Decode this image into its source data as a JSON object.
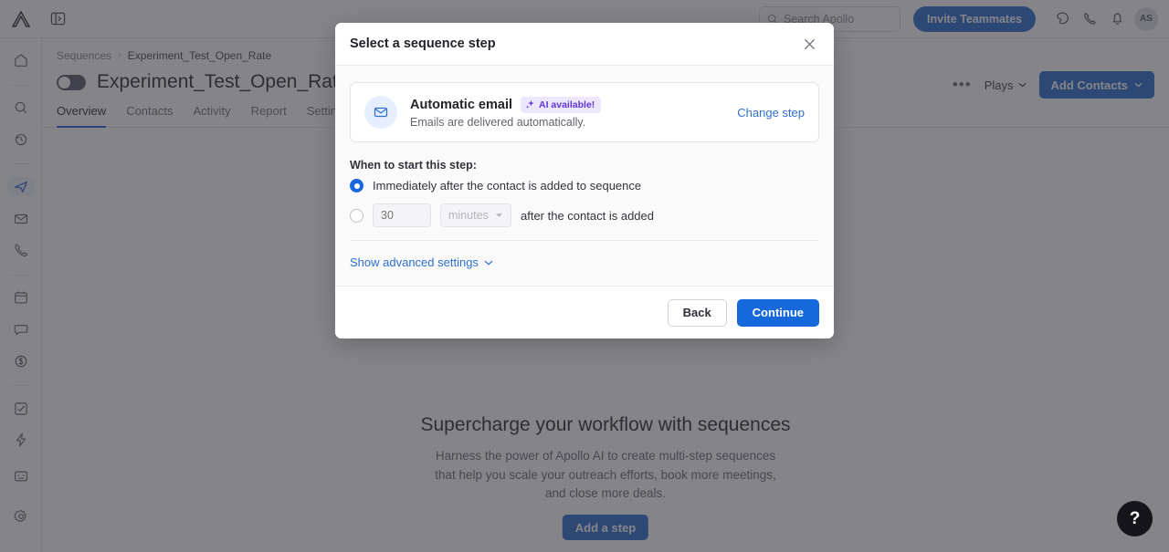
{
  "topbar": {
    "logo": "apollo-logo",
    "panel_toggle_icon": "panel-toggle-icon",
    "search": {
      "placeholder": "Search Apollo",
      "icon": "search-icon"
    },
    "invite_label": "Invite Teammates",
    "icons": [
      "tag-icon",
      "phone-icon",
      "bell-icon"
    ],
    "avatar_initials": "AS"
  },
  "rail": {
    "items": [
      {
        "name": "home",
        "icon": "home-icon",
        "active": false
      },
      {
        "name": "search",
        "icon": "search-icon",
        "active": false
      },
      {
        "name": "data-refresh",
        "icon": "data-refresh-icon",
        "active": false
      },
      {
        "name": "sequences",
        "icon": "send-icon",
        "active": true
      },
      {
        "name": "emails",
        "icon": "envelope-icon",
        "active": false
      },
      {
        "name": "calls",
        "icon": "phone-icon",
        "active": false
      },
      {
        "name": "meetings",
        "icon": "calendar-icon",
        "active": false
      },
      {
        "name": "conversations",
        "icon": "chat-icon",
        "active": false
      },
      {
        "name": "deals",
        "icon": "dollar-icon",
        "active": false
      },
      {
        "name": "tasks",
        "icon": "checkbox-icon",
        "active": false
      },
      {
        "name": "automations",
        "icon": "lightning-icon",
        "active": false
      }
    ],
    "bottom": [
      {
        "name": "apps",
        "icon": "grid-icon"
      },
      {
        "name": "settings",
        "icon": "gear-icon"
      }
    ]
  },
  "page": {
    "breadcrumb": {
      "parent": "Sequences",
      "separator": "›",
      "current": "Experiment_Test_Open_Rate"
    },
    "title": "Experiment_Test_Open_Rate",
    "toggle_state": "off",
    "star_icon": "star-icon",
    "tabs": [
      {
        "label": "Overview",
        "active": true
      },
      {
        "label": "Contacts",
        "active": false
      },
      {
        "label": "Activity",
        "active": false
      },
      {
        "label": "Report",
        "active": false
      },
      {
        "label": "Settings",
        "active": false
      }
    ],
    "actions": {
      "more_label": "•••",
      "plays_label": "Plays",
      "add_contacts_label": "Add Contacts"
    },
    "empty_state": {
      "title": "Supercharge your workflow with sequences",
      "subtitle_line1": "Harness the power of Apollo AI to create multi-step sequences",
      "subtitle_line2": "that help you scale your outreach efforts, book more meetings,",
      "subtitle_line3": "and close more deals.",
      "cta_label": "Add a step"
    },
    "help_label": "?"
  },
  "modal": {
    "title": "Select a sequence step",
    "close_icon": "close-icon",
    "step": {
      "icon": "envelope-icon",
      "title": "Automatic email",
      "badge": {
        "label": "AI available!",
        "icon": "sparkle-icon"
      },
      "description": "Emails are delivered automatically.",
      "change_label": "Change step"
    },
    "when_label": "When to start this step:",
    "options": [
      {
        "label": "Immediately after the contact is added to sequence",
        "selected": true
      },
      {
        "label": "after the contact is added",
        "selected": false
      }
    ],
    "delay": {
      "value_placeholder": "30",
      "unit": "minutes",
      "suffix": "after the contact is added"
    },
    "advanced_label": "Show advanced settings",
    "footer": {
      "back_label": "Back",
      "continue_label": "Continue"
    }
  },
  "colors": {
    "accent_blue": "#1668dc",
    "brand_blue": "#2f6fd0",
    "ai_purple": "#6236d9",
    "hero_dark": "#413e52"
  }
}
